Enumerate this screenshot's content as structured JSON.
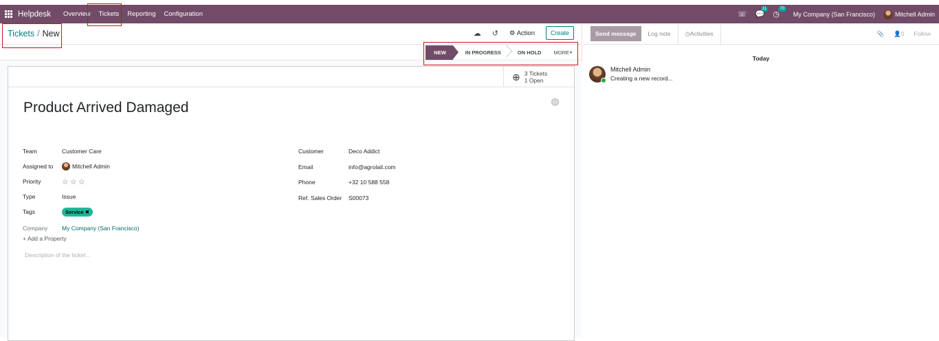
{
  "navbar": {
    "brand": "Helpdesk",
    "menu": [
      "Overview",
      "Tickets",
      "Reporting",
      "Configuration"
    ],
    "messages_count": "11",
    "activities_count": "70",
    "company": "My Company (San Francisco)",
    "user": "Mitchell Admin"
  },
  "breadcrumb": {
    "parent": "Tickets",
    "current": "New"
  },
  "actions": {
    "action_label": "Action",
    "create_label": "Create"
  },
  "stages": {
    "active": "NEW",
    "items": [
      "IN PROGRESS",
      "ON HOLD"
    ],
    "more": "MORE"
  },
  "smart_button": {
    "line1": "3 Tickets",
    "line2": "1 Open"
  },
  "ticket": {
    "title": "Product Arrived Damaged",
    "left_fields": [
      {
        "label": "Team",
        "value": "Customer Care"
      },
      {
        "label": "Assigned to",
        "value": "Mitchell Admin"
      },
      {
        "label": "Priority",
        "value": "☆☆☆"
      },
      {
        "label": "Type",
        "value": "Issue"
      },
      {
        "label": "Tags",
        "value": "Service"
      },
      {
        "label": "Company",
        "value": "My Company (San Francisco)"
      }
    ],
    "right_fields": [
      {
        "label": "Customer",
        "value": "Deco Addict"
      },
      {
        "label": "Email",
        "value": "info@agrolait.com"
      },
      {
        "label": "Phone",
        "value": "+32 10 588 558"
      },
      {
        "label": "Ref. Sales Order",
        "value": "S00073"
      }
    ],
    "add_property": "Add a Property",
    "description_placeholder": "Description of the ticket..."
  },
  "chatter": {
    "send_message": "Send message",
    "log_note": "Log note",
    "activities": "Activities",
    "followers_count": "0",
    "follow": "Follow",
    "date_separator": "Today",
    "message_author": "Mitchell Admin",
    "message_body": "Creating a new record..."
  },
  "colors": {
    "brand": "#714b67",
    "accent": "#017e84",
    "tag": "#21b799"
  }
}
